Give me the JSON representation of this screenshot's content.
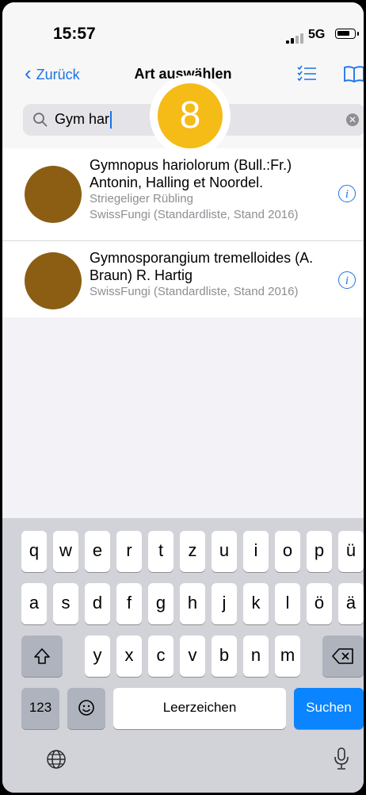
{
  "status": {
    "time": "15:57",
    "network": "5G"
  },
  "nav": {
    "back_label": "Zurück",
    "title": "Art auswählen"
  },
  "search": {
    "value": "Gym har"
  },
  "badge": {
    "number": "8"
  },
  "results": [
    {
      "name": "Gymnopus hariolorum (Bull.:Fr.) Antonin, Halling et Noordel.",
      "common_name": "Striegeliger Rübling",
      "source": "SwissFungi (Standardliste, Stand 2016)"
    },
    {
      "name": "Gymnosporangium tremelloides (A. Braun) R. Hartig",
      "common_name": "",
      "source": "SwissFungi (Standardliste, Stand 2016)"
    }
  ],
  "keyboard": {
    "row1": [
      "q",
      "w",
      "e",
      "r",
      "t",
      "z",
      "u",
      "i",
      "o",
      "p",
      "ü"
    ],
    "row2": [
      "a",
      "s",
      "d",
      "f",
      "g",
      "h",
      "j",
      "k",
      "l",
      "ö",
      "ä"
    ],
    "row3": [
      "y",
      "x",
      "c",
      "v",
      "b",
      "n",
      "m"
    ],
    "numbers_label": "123",
    "space_label": "Leerzeichen",
    "return_label": "Suchen"
  },
  "colors": {
    "accent": "#1a73e8",
    "badge": "#f5bb16",
    "thumbnail": "#8b5e14",
    "keyboard_bg": "#d1d3d9"
  }
}
